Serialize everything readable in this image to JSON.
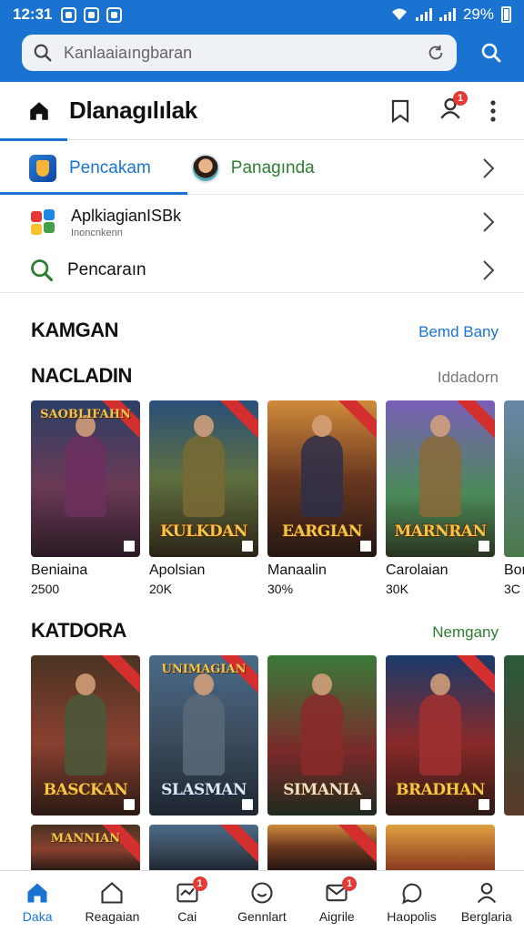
{
  "status_bar": {
    "time": "12:31",
    "battery": "29%"
  },
  "search": {
    "placeholder": "Kanlaaiaıngbaran"
  },
  "header": {
    "title": "Dlanagılılak",
    "notification_count": "1"
  },
  "row_tabs": {
    "tab_a": "Pencakam",
    "tab_b": "Panagında"
  },
  "row_app": {
    "title": "AplkiagianISBk",
    "subtitle": "Inoncnkenn"
  },
  "row_search": {
    "title": "Pencaraın"
  },
  "section_main": {
    "heading": "KAMGAN",
    "action": "Bemd Bany"
  },
  "section_one": {
    "heading": "NACLADIN",
    "action": "Iddadorn",
    "items": [
      {
        "top_caption": "SAOBLIFAHN",
        "caption": "",
        "name": "Beniaina",
        "count": "2500"
      },
      {
        "top_caption": "",
        "caption": "KULKDAN",
        "name": "Apolsian",
        "count": "20K"
      },
      {
        "top_caption": "",
        "caption": "EARGIAN",
        "name": "Manaalin",
        "count": "30%"
      },
      {
        "top_caption": "",
        "caption": "MARNRAN",
        "name": "Carolaian",
        "count": "30K"
      },
      {
        "top_caption": "",
        "caption": "",
        "name": "Bon",
        "count": "3C"
      }
    ]
  },
  "section_two": {
    "heading": "KATDORA",
    "action": "Nemgany",
    "items": [
      {
        "top_caption": "",
        "caption": "BASCKAN"
      },
      {
        "top_caption": "UNIMAGIAN",
        "caption": "SLASMAN"
      },
      {
        "top_caption": "",
        "caption": "SIMANIA"
      },
      {
        "top_caption": "",
        "caption": "BRADHAN"
      },
      {
        "top_caption": "",
        "caption": ""
      }
    ]
  },
  "section_three": {
    "items": [
      {
        "top_caption": "MANNIAN"
      },
      {
        "top_caption": ""
      },
      {
        "top_caption": ""
      },
      {
        "top_caption": ""
      }
    ]
  },
  "bottom_nav": {
    "items": [
      {
        "label": "Daka",
        "icon": "home-icon"
      },
      {
        "label": "Reagaian",
        "icon": "house-outline-icon"
      },
      {
        "label": "Cai",
        "icon": "inbox-icon",
        "badge": "1"
      },
      {
        "label": "Gennlart",
        "icon": "smile-icon"
      },
      {
        "label": "Aigrile",
        "icon": "mail-icon",
        "badge": "1"
      },
      {
        "label": "Haopolis",
        "icon": "chat-icon"
      },
      {
        "label": "Berglaria",
        "icon": "person-icon"
      }
    ]
  },
  "colors": {
    "accent": "#1a73d1",
    "green": "#2e7d32",
    "badge": "#e53935"
  }
}
